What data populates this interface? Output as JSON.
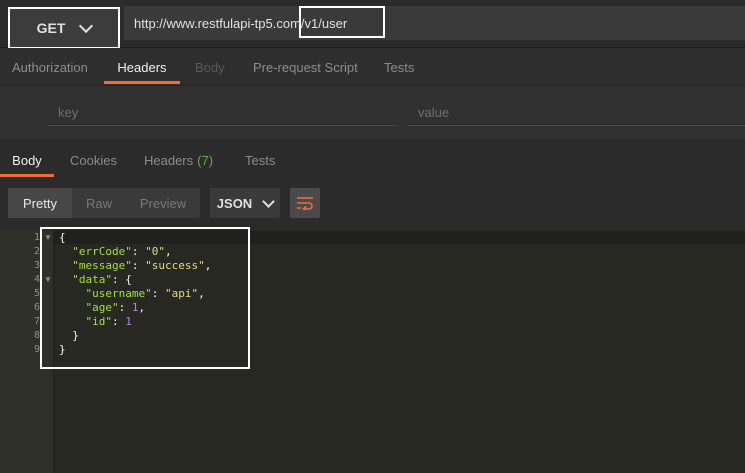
{
  "request": {
    "method": "GET",
    "url": "http://www.restfulapi-tp5.com/v1/user"
  },
  "request_tabs": [
    "Authorization",
    "Headers",
    "Body",
    "Pre-request Script",
    "Tests"
  ],
  "headers_editor": {
    "key_placeholder": "key",
    "value_placeholder": "value"
  },
  "response_tabs": {
    "body": "Body",
    "cookies": "Cookies",
    "headers": "Headers",
    "headers_count": "(7)",
    "tests": "Tests"
  },
  "view_modes": [
    "Pretty",
    "Raw",
    "Preview"
  ],
  "format": "JSON",
  "line_numbers": [
    "1",
    "2",
    "3",
    "4",
    "5",
    "6",
    "7",
    "8",
    "9"
  ],
  "response_json": {
    "errCode_key": "\"errCode\"",
    "errCode_val": "\"0\"",
    "message_key": "\"message\"",
    "message_val": "\"success\"",
    "data_key": "\"data\"",
    "username_key": "\"username\"",
    "username_val": "\"api\"",
    "age_key": "\"age\"",
    "age_val": "1",
    "id_key": "\"id\"",
    "id_val": "1"
  },
  "colors": {
    "accent": "#f26b3a",
    "header_count": "#6aa84f",
    "json_key": "#a6e22e",
    "json_string": "#e6db74",
    "json_number": "#ae81ff"
  }
}
